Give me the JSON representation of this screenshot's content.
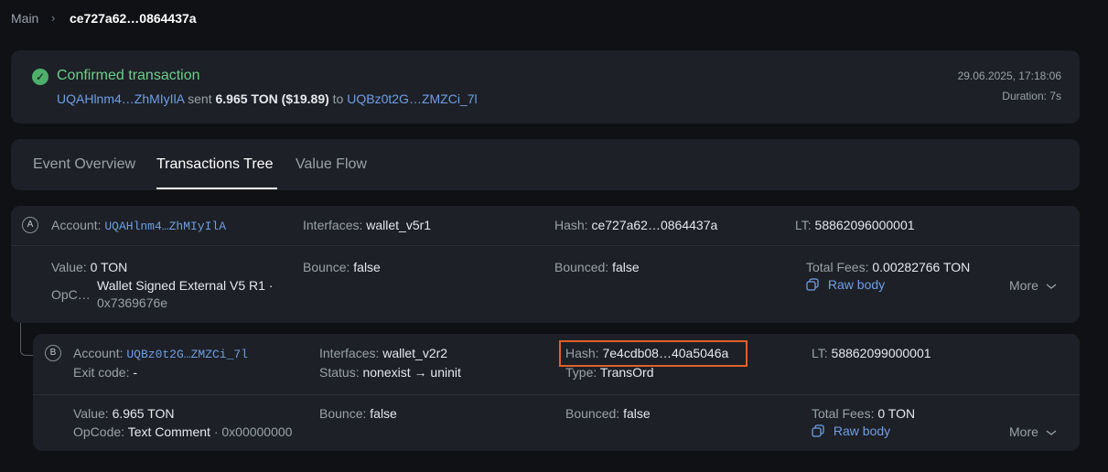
{
  "breadcrumb": {
    "root": "Main",
    "separator": "›",
    "current": "ce727a62…0864437a"
  },
  "status": {
    "check_glyph": "✓",
    "title": "Confirmed transaction",
    "from": "UQAHlnm4…ZhMIyIlA",
    "sent_word": "sent",
    "amount": "6.965 TON",
    "amount_usd": "($19.89)",
    "to_word": "to",
    "to": "UQBz0t2G…ZMZCi_7l",
    "datetime": "29.06.2025, 17:18:06",
    "duration": "Duration: 7s"
  },
  "tabs": [
    {
      "label": "Event Overview",
      "active": false
    },
    {
      "label": "Transactions Tree",
      "active": true
    },
    {
      "label": "Value Flow",
      "active": false
    }
  ],
  "nodes": [
    {
      "badge": "A",
      "account_label": "Account:",
      "account": "UQAHlnm4…ZhMIyIlA",
      "interfaces_label": "Interfaces:",
      "interfaces": "wallet_v5r1",
      "hash_label": "Hash:",
      "hash": "ce727a62…0864437a",
      "lt_label": "LT:",
      "lt": "58862096000001",
      "value_label": "Value:",
      "value": "0 TON",
      "opcode_label": "OpC…",
      "opcode_line1": "Wallet Signed External V5 R1 ·",
      "opcode_line2": "0x7369676e",
      "bounce_label": "Bounce:",
      "bounce": "false",
      "bounced_label": "Bounced:",
      "bounced": "false",
      "fees_label": "Total Fees:",
      "fees": "0.00282766 TON",
      "raw_body": "Raw body",
      "more": "More"
    },
    {
      "badge": "B",
      "account_label": "Account:",
      "account": "UQBz0t2G…ZMZCi_7l",
      "exit_label": "Exit code:",
      "exit": "-",
      "interfaces_label": "Interfaces:",
      "interfaces": "wallet_v2r2",
      "status_label": "Status:",
      "status": "nonexist → uninit",
      "hash_label": "Hash:",
      "hash": "7e4cdb08…40a5046a",
      "type_label": "Type:",
      "type": "TransOrd",
      "lt_label": "LT:",
      "lt": "58862099000001",
      "value_label": "Value:",
      "value": "6.965 TON",
      "opcode_label": "OpCode:",
      "opcode": "Text Comment",
      "opcode_hex": "· 0x00000000",
      "bounce_label": "Bounce:",
      "bounce": "false",
      "bounced_label": "Bounced:",
      "bounced": "false",
      "fees_label": "Total Fees:",
      "fees": "0 TON",
      "raw_body": "Raw body",
      "more": "More"
    }
  ],
  "colors": {
    "background": "#0f1114",
    "card": "#1d2026",
    "link": "#6f9fe6",
    "success": "#6ccf8a",
    "highlight": "#e0602a"
  }
}
